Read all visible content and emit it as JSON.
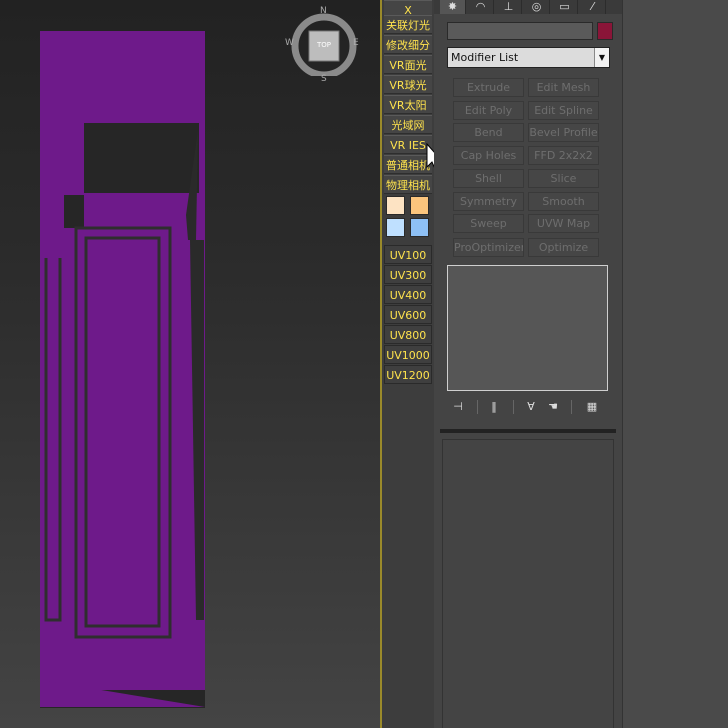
{
  "command_bar": {
    "buttons": [
      "X",
      "关联灯光",
      "修改细分",
      "VR面光",
      "VR球光",
      "VR太阳",
      "光域网",
      "VR IES",
      "普通相机",
      "物理相机"
    ],
    "uv_buttons": [
      "UV100",
      "UV300",
      "UV400",
      "UV600",
      "UV800",
      "UV1000",
      "UV1200"
    ]
  },
  "command_panel": {
    "modifier_list": "Modifier List",
    "modifier_buttons": [
      "Extrude",
      "Edit Mesh",
      "Edit Poly",
      "Edit Spline",
      "Bend",
      "Bevel Profile",
      "Cap Holes",
      "FFD 2x2x2",
      "Shell",
      "Slice",
      "Symmetry",
      "Smooth",
      "Sweep",
      "UVW Map",
      "ProOptimizer",
      "Optimize"
    ],
    "object_color": "#8a1538"
  },
  "viewcube": {
    "label": "TOP",
    "north": "N",
    "south": "S",
    "east": "E",
    "west": "W"
  },
  "colors": {
    "geometry": "#6e1a8a",
    "button_text": "#ffe34d"
  }
}
